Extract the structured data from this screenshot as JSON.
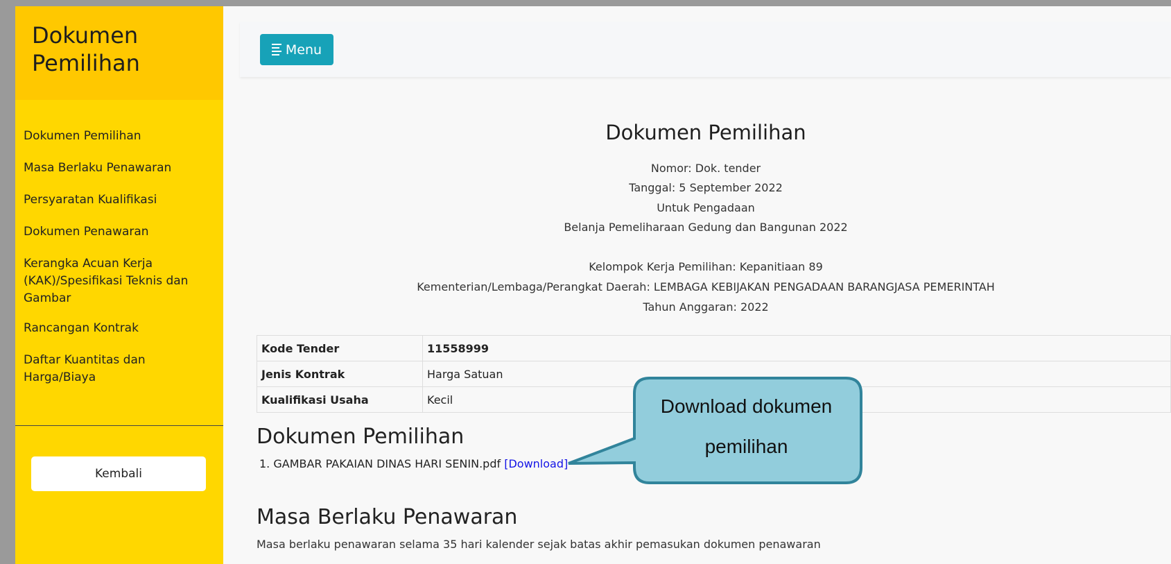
{
  "sidebar": {
    "title": "Dokumen Pemilihan",
    "items": [
      {
        "label": "Dokumen Pemilihan"
      },
      {
        "label": "Masa Berlaku Penawaran"
      },
      {
        "label": "Persyaratan Kualifikasi"
      },
      {
        "label": "Dokumen Penawaran"
      },
      {
        "label": "Kerangka Acuan Kerja (KAK)/Spesifikasi Teknis dan Gambar"
      },
      {
        "label": "Rancangan Kontrak"
      },
      {
        "label": "Daftar Kuantitas dan Harga/Biaya"
      }
    ],
    "back_label": "Kembali"
  },
  "topbar": {
    "menu_label": "Menu",
    "menu_icon": "bars-icon"
  },
  "document": {
    "heading": "Dokumen Pemilihan",
    "nomor": "Nomor: Dok. tender",
    "tanggal": "Tanggal: 5 September 2022",
    "untuk": "Untuk Pengadaan",
    "paket": "Belanja Pemeliharaan Gedung dan Bangunan 2022",
    "pokja": "Kelompok Kerja Pemilihan: Kepanitiaan 89",
    "klpd": "Kementerian/Lembaga/Perangkat Daerah: LEMBAGA KEBIJAKAN PENGADAAN BARANGJASA PEMERINTAH",
    "tahun": "Tahun Anggaran: 2022"
  },
  "info_table": [
    {
      "label": "Kode Tender",
      "value": "11558999"
    },
    {
      "label": "Jenis Kontrak",
      "value": "Harga Satuan"
    },
    {
      "label": "Kualifikasi Usaha",
      "value": "Kecil"
    }
  ],
  "sections": {
    "dokumen_title": "Dokumen Pemilihan",
    "file_name": "1. GAMBAR PAKAIAN DINAS HARI SENIN.pdf",
    "download_label": "[Download]",
    "masa_title": "Masa Berlaku Penawaran",
    "masa_text": "Masa berlaku penawaran selama 35 hari kalender sejak batas akhir pemasukan dokumen penawaran"
  },
  "callout": {
    "line1": "Download dokumen",
    "line2": "pemilihan"
  },
  "colors": {
    "sidebar": "#ffd700",
    "sidebar_header": "#ffc800",
    "menu_button": "#17a2b8",
    "callout_fill": "#92cddc",
    "callout_border": "#31849b",
    "link": "#1414e6"
  }
}
